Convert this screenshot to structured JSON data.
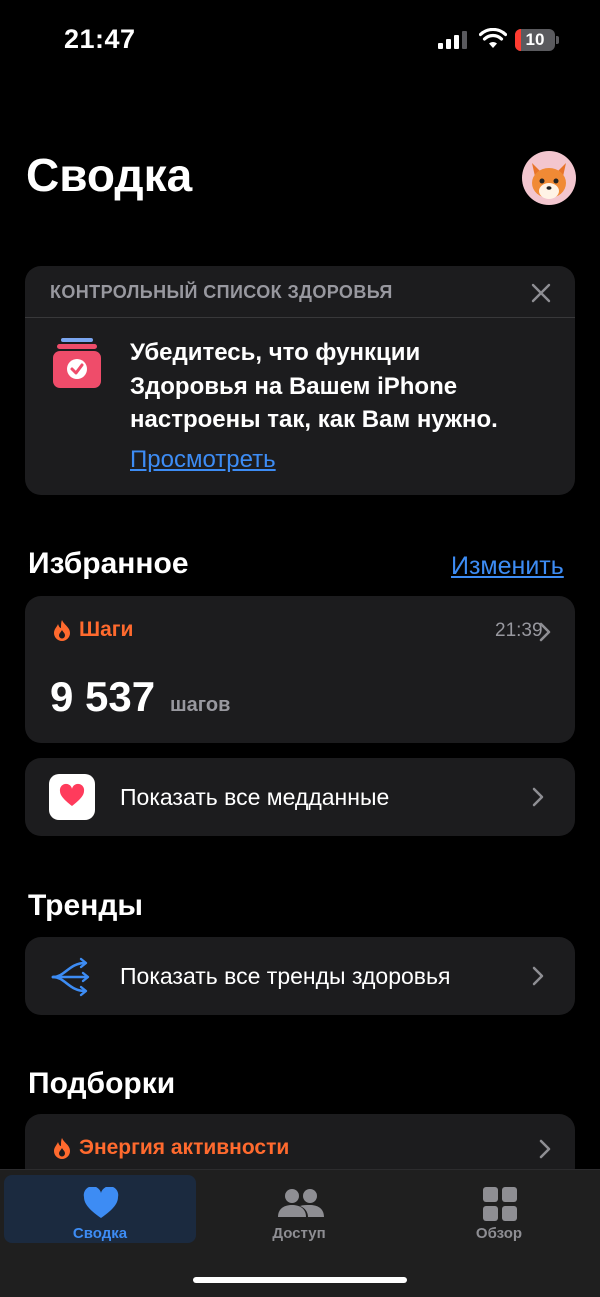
{
  "status": {
    "time": "21:47",
    "battery": "10"
  },
  "header": {
    "title": "Сводка",
    "avatar_icon": "fox-memoji-avatar"
  },
  "checklist": {
    "header": "КОНТРОЛЬНЫЙ СПИСОК ЗДОРОВЬЯ",
    "message_lines": [
      "Убедитесь, что функции",
      "Здоровья на Вашем iPhone",
      "настроены так, как Вам нужно."
    ],
    "link": "Просмотреть"
  },
  "favorites": {
    "title": "Избранное",
    "edit_label": "Изменить",
    "steps": {
      "title": "Шаги",
      "time": "21:39",
      "value": "9 537",
      "unit": "шагов"
    },
    "show_all": "Показать все медданные"
  },
  "trends": {
    "title": "Тренды",
    "show_all": "Показать все тренды здоровья"
  },
  "highlights": {
    "title": "Подборки",
    "energy_title": "Энергия активности"
  },
  "tabbar": {
    "tabs": [
      {
        "label": "Сводка",
        "icon": "heart-icon",
        "active": true
      },
      {
        "label": "Доступ",
        "icon": "people-icon",
        "active": false
      },
      {
        "label": "Обзор",
        "icon": "grid-icon",
        "active": false
      }
    ]
  },
  "colors": {
    "accent": "#3d8cf4",
    "activity": "#ff6a2e",
    "card": "#1c1c1e",
    "background": "#000000"
  }
}
